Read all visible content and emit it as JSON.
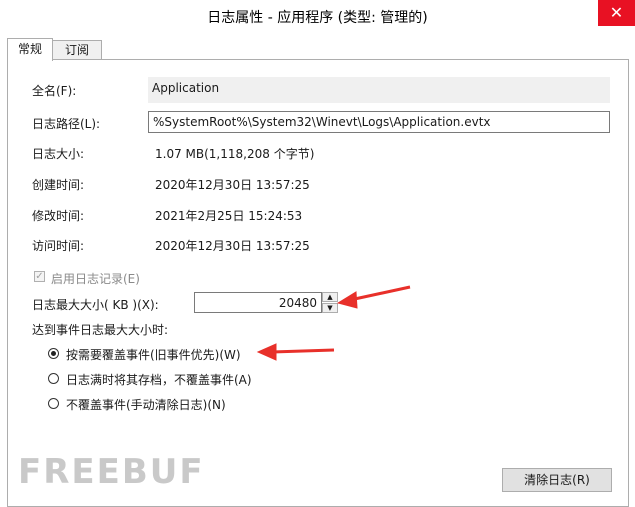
{
  "window": {
    "title": "日志属性 - 应用程序 (类型: 管理的)",
    "close_glyph": "✕"
  },
  "tabs": [
    {
      "label": "常规",
      "active": true
    },
    {
      "label": "订阅",
      "active": false
    }
  ],
  "general": {
    "full_name_label": "全名(F):",
    "full_name_value": "Application",
    "log_path_label": "日志路径(L):",
    "log_path_value": "%SystemRoot%\\System32\\Winevt\\Logs\\Application.evtx",
    "log_size_label": "日志大小:",
    "log_size_value": "1.07 MB(1,118,208 个字节)",
    "created_label": "创建时间:",
    "created_value": "2020年12月30日 13:57:25",
    "modified_label": "修改时间:",
    "modified_value": "2021年2月25日 15:24:53",
    "accessed_label": "访问时间:",
    "accessed_value": "2020年12月30日 13:57:25"
  },
  "logging": {
    "enable_label": "启用日志记录(E)",
    "enable_checked": true,
    "max_size_label": "日志最大大小( KB )(X):",
    "max_size_value": "20480",
    "when_max_label": "达到事件日志最大大小时:",
    "options": [
      {
        "label": "按需要覆盖事件(旧事件优先)(W)",
        "selected": true
      },
      {
        "label": "日志满时将其存档，不覆盖事件(A)",
        "selected": false
      },
      {
        "label": "不覆盖事件(手动清除日志)(N)",
        "selected": false
      }
    ]
  },
  "buttons": {
    "clear_log": "清除日志(R)"
  },
  "watermark": "FREEBUF",
  "colors": {
    "close": "#e81123",
    "annotation_arrow": "#e8302a"
  }
}
